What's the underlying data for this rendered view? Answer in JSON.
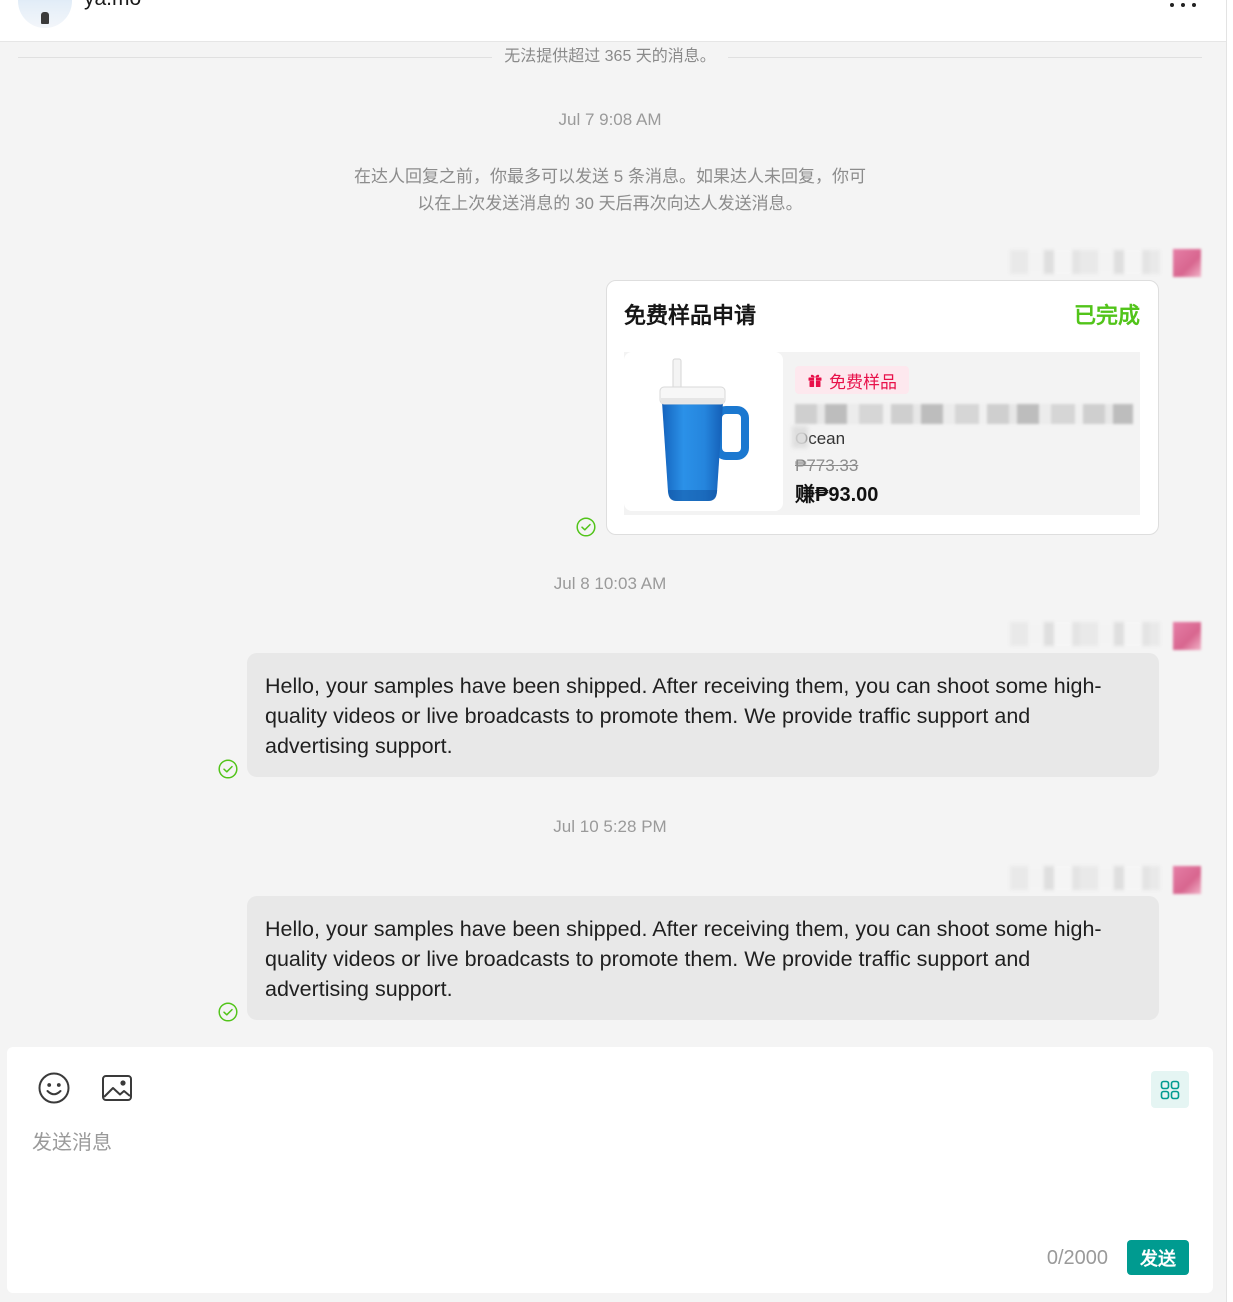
{
  "header": {
    "contact_name": "ya.mo",
    "avatar_icon": "contact-avatar",
    "more_icon": "more-horizontal-icon"
  },
  "thread": {
    "notice": "无法提供超过 365 天的消息。",
    "system_message": [
      "在达人回复之前，你最多可以发送 5 条消息。如果达人未回复，你可",
      "以在上次发送消息的 30 天后再次向达人发送消息。"
    ],
    "groups": [
      {
        "timestamp": "Jul 7 9:08 AM",
        "status_icon": "check-circle-icon"
      },
      {
        "timestamp": "Jul 8 10:03 AM",
        "status_icon": "check-circle-icon",
        "text": "Hello, your samples have been shipped. After receiving them, you can shoot some high-quality videos or live broadcasts to promote them. We provide traffic support and advertising support."
      },
      {
        "timestamp": "Jul 10 5:28 PM",
        "status_icon": "check-circle-icon",
        "text": "Hello, your samples have been shipped. After receiving them, you can shoot some high-quality videos or live broadcasts to promote them. We provide traffic support and advertising support."
      }
    ]
  },
  "sample_card": {
    "title": "免费样品申请",
    "status": "已完成",
    "product": {
      "image_icon": "tumbler-product-image",
      "badge_icon": "gift-icon",
      "badge": "免费样品",
      "name_partial": "Ocean",
      "original_price": "₱773.33",
      "earn": "赚₱93.00"
    }
  },
  "composer": {
    "emoji_icon": "emoji-icon",
    "image_icon": "image-icon",
    "apps_icon": "grid-icon",
    "placeholder": "发送消息",
    "counter": "0/2000",
    "send_label": "发送"
  },
  "colors": {
    "accent": "#009b90",
    "status_complete": "#52c41a",
    "badge_text": "#e8114a",
    "badge_bg": "#fde8ee",
    "bubble_bg": "#e8e8e8",
    "page_bg": "#f4f4f4",
    "check": "#52c41a"
  }
}
